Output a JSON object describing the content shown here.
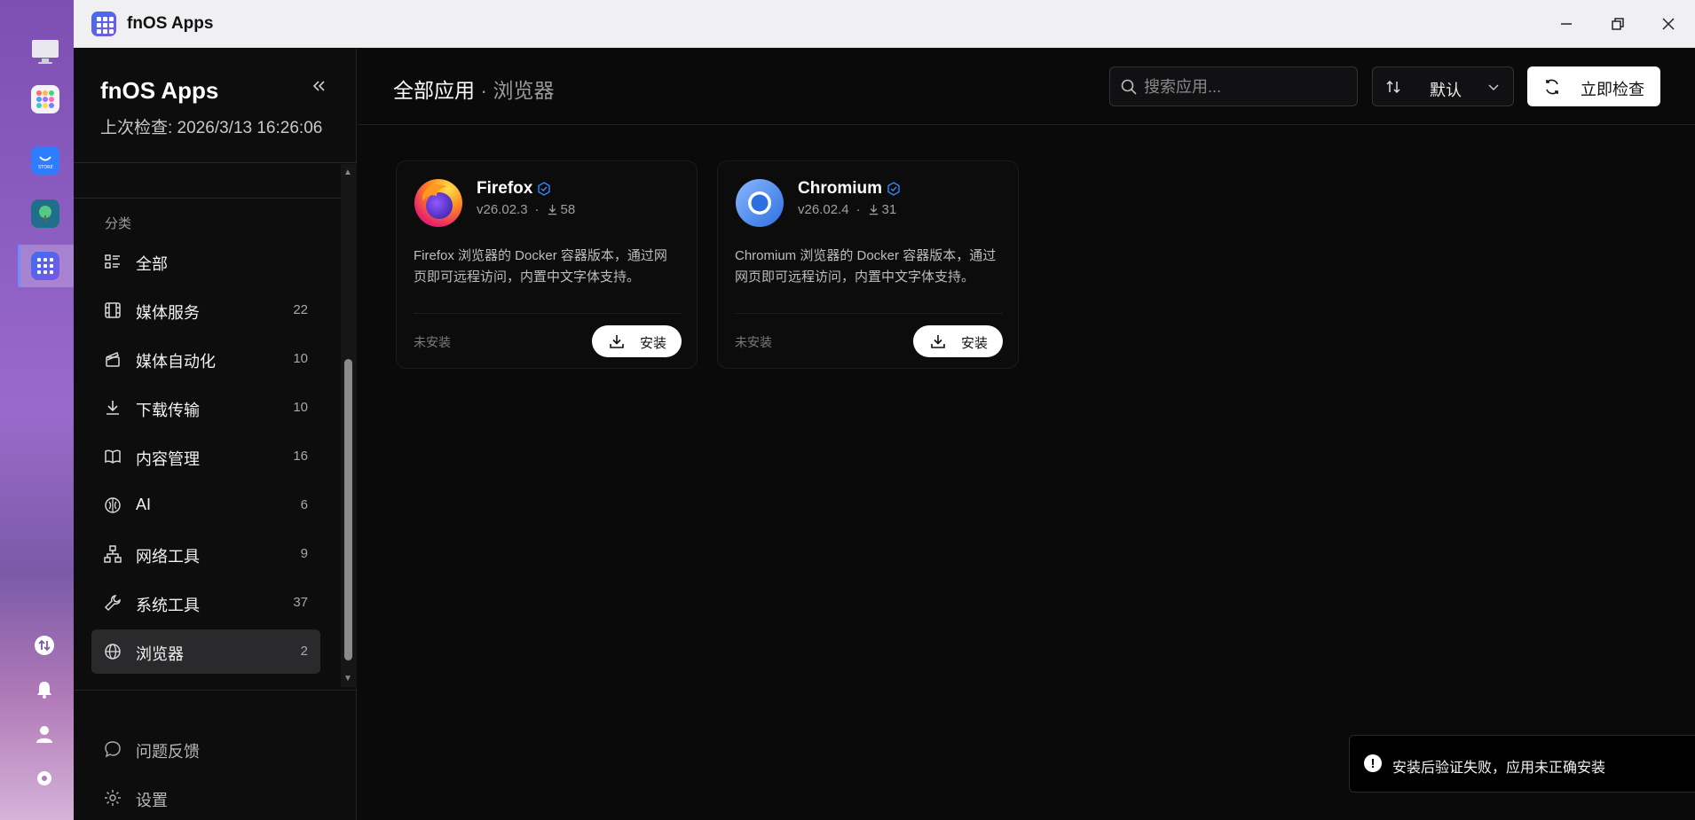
{
  "window": {
    "title": "fnOS Apps"
  },
  "sidebar": {
    "brand": "fnOS Apps",
    "last_check": "上次检查: 2026/3/13 16:26:06",
    "section_label": "分类",
    "categories": [
      {
        "label": "全部",
        "count": "",
        "icon": "list-icon"
      },
      {
        "label": "媒体服务",
        "count": "22",
        "icon": "film-icon"
      },
      {
        "label": "媒体自动化",
        "count": "10",
        "icon": "clapperboard-icon"
      },
      {
        "label": "下载传输",
        "count": "10",
        "icon": "download-icon"
      },
      {
        "label": "内容管理",
        "count": "16",
        "icon": "book-icon"
      },
      {
        "label": "AI",
        "count": "6",
        "icon": "brain-icon"
      },
      {
        "label": "网络工具",
        "count": "9",
        "icon": "network-icon"
      },
      {
        "label": "系统工具",
        "count": "37",
        "icon": "wrench-icon"
      },
      {
        "label": "浏览器",
        "count": "2",
        "icon": "globe-icon",
        "active": true
      }
    ],
    "footer": [
      {
        "label": "问题反馈",
        "icon": "message-icon"
      },
      {
        "label": "设置",
        "icon": "gear-icon"
      }
    ]
  },
  "main": {
    "breadcrumb_root": "全部应用",
    "breadcrumb_current": "· 浏览器",
    "search_placeholder": "搜索应用...",
    "sort_label": "默认",
    "check_button": "立即检查",
    "apps": [
      {
        "name": "Firefox",
        "version": "v26.02.3",
        "downloads": "58",
        "description": "Firefox 浏览器的 Docker 容器版本，通过网页即可远程访问，内置中文字体支持。",
        "status": "未安装",
        "install_label": "安装"
      },
      {
        "name": "Chromium",
        "version": "v26.02.4",
        "downloads": "31",
        "description": "Chromium 浏览器的 Docker 容器版本，通过网页即可远程访问，内置中文字体支持。",
        "status": "未安装",
        "install_label": "安装"
      }
    ]
  },
  "toast": {
    "message": "安装后验证失败，应用未正确安装"
  },
  "colors": {
    "accent": "#3a86ff",
    "active_item": "#2a2a2c",
    "dock_active": "#6c8cff"
  }
}
